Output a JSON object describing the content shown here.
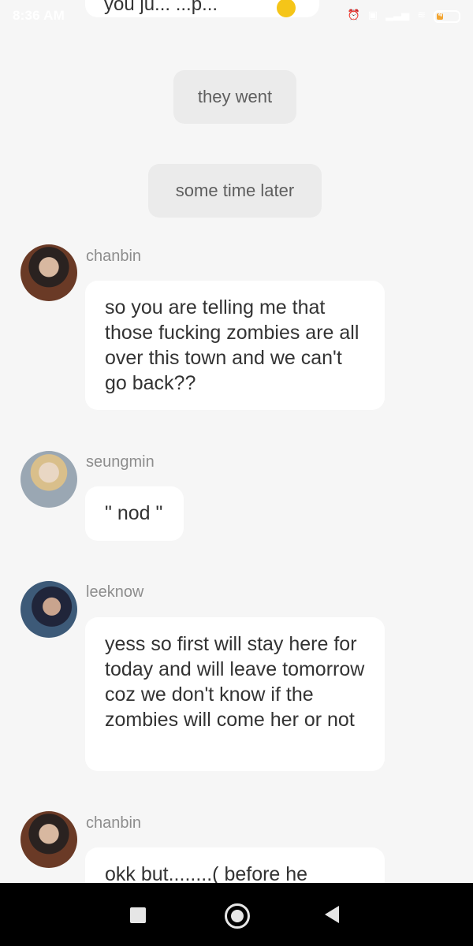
{
  "status_bar": {
    "time": "8:36 AM",
    "icons": [
      "alarm-icon",
      "screenshot-icon",
      "signal-icon",
      "wifi-icon",
      "battery-icon"
    ],
    "battery_level": "4"
  },
  "top_message": {
    "text": "you ju... ...p...",
    "emoji": "smiley-face-icon"
  },
  "narration": [
    {
      "text": "they went"
    },
    {
      "text": "some time later"
    }
  ],
  "messages": [
    {
      "sender": "chanbin",
      "text": "so you are telling me that those fucking zombies are all over this town and we can't go back??"
    },
    {
      "sender": "seungmin",
      "text": "\" nod \""
    },
    {
      "sender": "leeknow",
      "text": "yess so first will stay here for today and will leave tomorrow coz we don't know if the zombies will come her or not"
    },
    {
      "sender": "chanbin",
      "text": "okk but........( before he"
    }
  ],
  "nav_bar": {
    "buttons": [
      "recents-square-icon",
      "home-circle-icon",
      "back-triangle-icon"
    ]
  },
  "colors": {
    "background": "#f6f6f6",
    "bubble": "#ffffff",
    "narration_pill": "#ebebeb",
    "sender_text": "#8d8d8d",
    "message_text": "#333333",
    "nav_bar": "#000000"
  }
}
